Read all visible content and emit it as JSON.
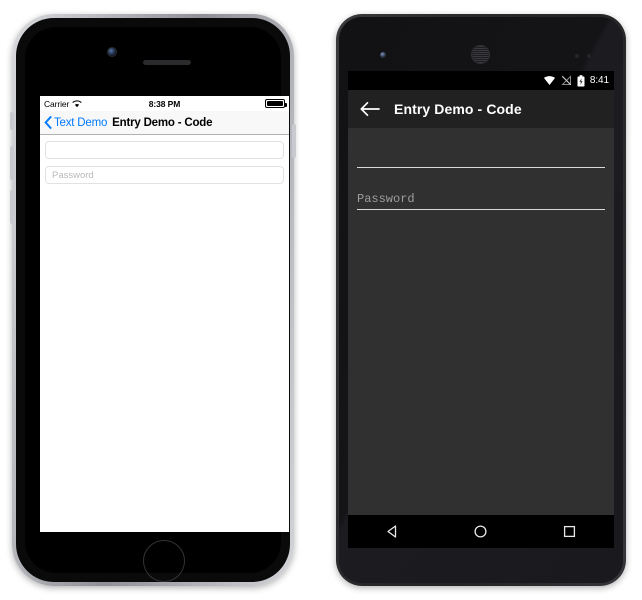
{
  "page": {
    "background": "#ffffff",
    "accent_ios": "#007aff",
    "android_actionbar": "#212121",
    "android_background": "#303030"
  },
  "ios_device": {
    "name": "iPhone",
    "status_bar": {
      "carrier": "Carrier",
      "wifi_icon": "wifi-icon",
      "time": "8:38 PM",
      "battery_icon": "battery-full-icon"
    },
    "nav_bar": {
      "back_icon": "chevron-left-icon",
      "back_label": "Text Demo",
      "title": "Entry Demo - Code"
    },
    "entries": [
      {
        "name": "entry-username",
        "value": "",
        "placeholder": ""
      },
      {
        "name": "entry-password",
        "value": "",
        "placeholder": "Password"
      }
    ],
    "hardware": {
      "camera_icon": "front-camera-icon",
      "speaker_icon": "earpiece-speaker-icon",
      "home_button_icon": "home-button-icon",
      "silent_switch": "silent-switch",
      "volume_up": "volume-up-button",
      "volume_down": "volume-down-button",
      "power_button": "power-button"
    }
  },
  "android_device": {
    "name": "Android",
    "status_bar": {
      "wifi_icon": "wifi-icon",
      "signal_icon": "signal-off-icon",
      "battery_icon": "battery-charging-icon",
      "time": "8:41"
    },
    "action_bar": {
      "back_icon": "arrow-left-icon",
      "title": "Entry Demo - Code"
    },
    "entries": [
      {
        "name": "entry-username",
        "value": "",
        "placeholder": ""
      },
      {
        "name": "entry-password",
        "value": "",
        "placeholder": "Password"
      }
    ],
    "nav_bar": {
      "back_icon": "nav-back-triangle-icon",
      "home_icon": "nav-home-circle-icon",
      "recents_icon": "nav-recents-square-icon"
    },
    "hardware": {
      "camera_icon": "front-camera-icon",
      "speaker_icon": "earpiece-speaker-icon",
      "sensor_icon": "proximity-sensor-icon"
    }
  }
}
